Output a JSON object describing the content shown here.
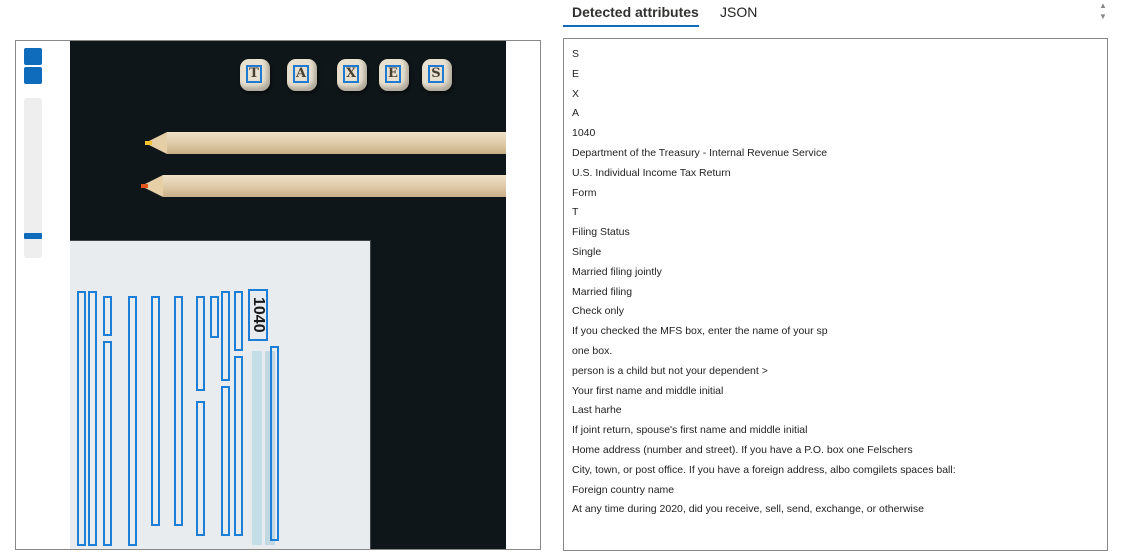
{
  "tabs": [
    {
      "label": "Detected attributes",
      "active": true
    },
    {
      "label": "JSON",
      "active": false
    }
  ],
  "viewer": {
    "tiles": [
      "T",
      "A",
      "X",
      "E",
      "S"
    ],
    "form_title": "1040",
    "form_subtitle": "U.S. Individual Income Tax Return"
  },
  "results": [
    "S",
    "E",
    "X",
    "A",
    "1040",
    "Department of the Treasury - Internal Revenue Service",
    "U.S. Individual Income Tax Return",
    "Form",
    "T",
    "Filing Status",
    "Single",
    "Married filing jointly",
    "Married filing",
    "Check only",
    "If you checked the MFS box, enter the name of your sp",
    "one box.",
    "person is a child but not your dependent >",
    "Your first name and middle initial",
    "Last harhe",
    "If joint return, spouse's first name and middle initial",
    "Home address (number and street). If you have a P.O. box one Felschers",
    "City, town, or post office. If you have a foreign address, albo comgilets spaces ball:",
    "Foreign country name",
    "At any time during 2020, did you receive, sell, send, exchange, or otherwise"
  ],
  "colors": {
    "accent": "#0f6cbd",
    "ocr_box": "#1c7ed6"
  },
  "icons": [
    "scroll-up-icon",
    "scroll-down-icon"
  ]
}
